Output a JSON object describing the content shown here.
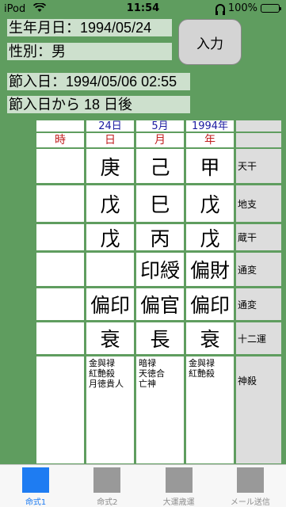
{
  "statusbar": {
    "carrier": "iPod",
    "time": "11:54",
    "battery": "100%"
  },
  "fields": {
    "birthdate": "生年月日：1994/05/24",
    "gender": "性別：男",
    "setsuiri": "節入日：1994/05/06 02:55",
    "days_after": "節入日から 18 日後"
  },
  "input_button": "入力",
  "headers": {
    "day": "24日",
    "month": "5月",
    "year": "1994年"
  },
  "pillar_labels": {
    "hour": "時",
    "day": "日",
    "month": "月",
    "year": "年"
  },
  "rows": [
    {
      "hour": "",
      "day": "庚",
      "month": "己",
      "year": "甲",
      "label": "天干"
    },
    {
      "hour": "",
      "day": "戊",
      "month": "巳",
      "year": "戊",
      "label": "地支"
    },
    {
      "hour": "",
      "day": "戊",
      "month": "丙",
      "year": "戊",
      "label": "蔵干"
    },
    {
      "hour": "",
      "day": "",
      "month": "印綬",
      "year": "偏財",
      "label": "通変"
    },
    {
      "hour": "",
      "day": "偏印",
      "month": "偏官",
      "year": "偏印",
      "label": "通変"
    },
    {
      "hour": "",
      "day": "衰",
      "month": "長",
      "year": "衰",
      "label": "十二運"
    },
    {
      "hour": "",
      "day": "金與禄\n紅艶殺\n月徳貴人",
      "month": "暗禄\n天徳合\n亡神",
      "year": "金與禄\n紅艶殺",
      "label": "神殺"
    }
  ],
  "tabs": [
    {
      "label": "命式1",
      "icon": "tab-square-icon",
      "active": true
    },
    {
      "label": "命式2",
      "icon": "tab-square-icon",
      "active": false
    },
    {
      "label": "大運歳運",
      "icon": "tab-square-icon",
      "active": false
    },
    {
      "label": "メール送信",
      "icon": "tab-square-icon",
      "active": false
    }
  ],
  "colors": {
    "background": "#5f9d5f",
    "header_text": "#1a1aa0",
    "pillar_text": "#c02020",
    "active_tab": "#1e7cf2"
  }
}
